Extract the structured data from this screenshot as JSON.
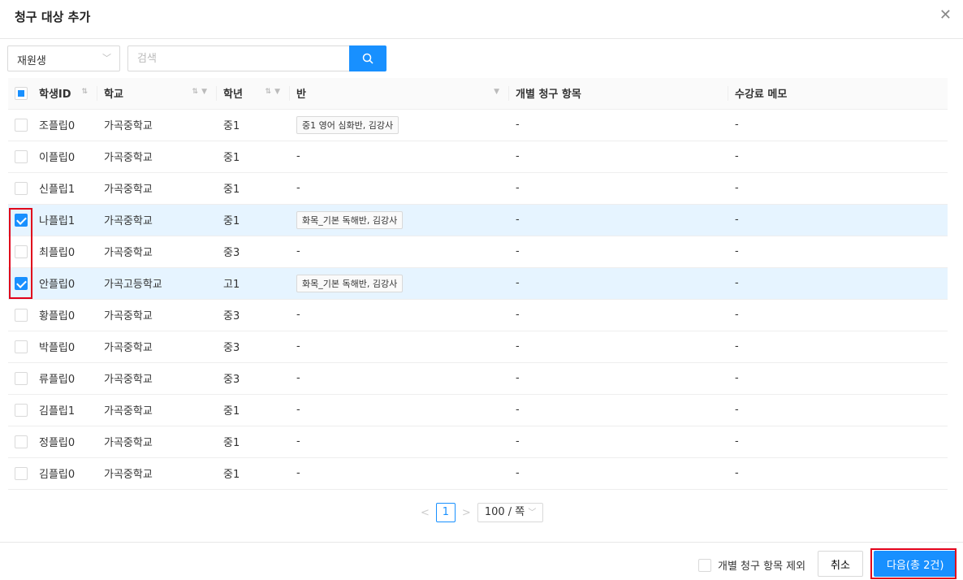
{
  "title": "청구 대상 추가",
  "filter": {
    "selected": "재원생",
    "search_placeholder": "검색"
  },
  "columns": [
    "학생ID",
    "학교",
    "학년",
    "반",
    "개별 청구 항목",
    "수강료 메모"
  ],
  "rows": [
    {
      "id": "조플립0",
      "school": "가곡중학교",
      "grade": "중1",
      "class": "중1 영어 심화반, 김강사",
      "item": "-",
      "memo": "-",
      "checked": false
    },
    {
      "id": "이플립0",
      "school": "가곡중학교",
      "grade": "중1",
      "class": "-",
      "item": "-",
      "memo": "-",
      "checked": false
    },
    {
      "id": "신플립1",
      "school": "가곡중학교",
      "grade": "중1",
      "class": "-",
      "item": "-",
      "memo": "-",
      "checked": false
    },
    {
      "id": "나플립1",
      "school": "가곡중학교",
      "grade": "중1",
      "class": "화목_기본 독해반, 김강사",
      "item": "-",
      "memo": "-",
      "checked": true
    },
    {
      "id": "최플립0",
      "school": "가곡중학교",
      "grade": "중3",
      "class": "-",
      "item": "-",
      "memo": "-",
      "checked": false
    },
    {
      "id": "안플립0",
      "school": "가곡고등학교",
      "grade": "고1",
      "class": "화목_기본 독해반, 김강사",
      "item": "-",
      "memo": "-",
      "checked": true
    },
    {
      "id": "황플립0",
      "school": "가곡중학교",
      "grade": "중3",
      "class": "-",
      "item": "-",
      "memo": "-",
      "checked": false
    },
    {
      "id": "박플립0",
      "school": "가곡중학교",
      "grade": "중3",
      "class": "-",
      "item": "-",
      "memo": "-",
      "checked": false
    },
    {
      "id": "류플립0",
      "school": "가곡중학교",
      "grade": "중3",
      "class": "-",
      "item": "-",
      "memo": "-",
      "checked": false
    },
    {
      "id": "김플립1",
      "school": "가곡중학교",
      "grade": "중1",
      "class": "-",
      "item": "-",
      "memo": "-",
      "checked": false
    },
    {
      "id": "정플립0",
      "school": "가곡중학교",
      "grade": "중1",
      "class": "-",
      "item": "-",
      "memo": "-",
      "checked": false
    },
    {
      "id": "김플립0",
      "school": "가곡중학교",
      "grade": "중1",
      "class": "-",
      "item": "-",
      "memo": "-",
      "checked": false
    }
  ],
  "pagination": {
    "current": "1",
    "page_size": "100 / 쪽"
  },
  "footer": {
    "exclude_label": "개별 청구 항목 제외",
    "cancel": "취소",
    "next": "다음(총 2건)"
  },
  "colors": {
    "primary": "#1890ff",
    "highlight": "#e0001b",
    "selected_row": "#e6f4ff"
  }
}
